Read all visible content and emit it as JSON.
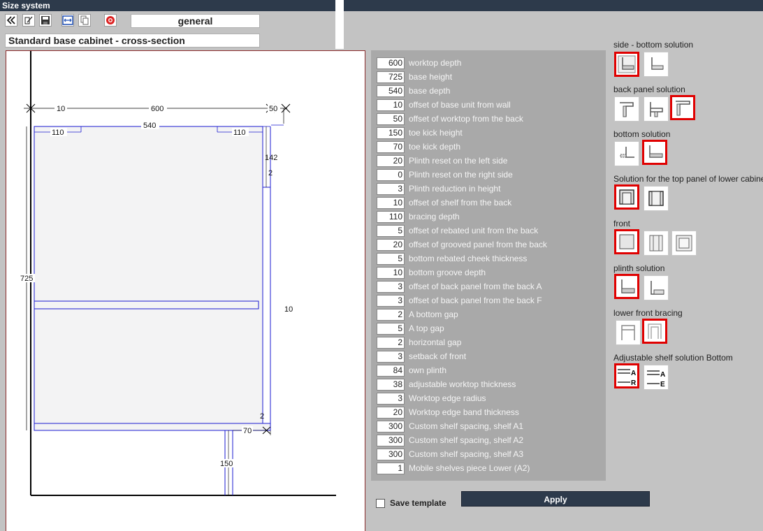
{
  "window": {
    "title": "Size system"
  },
  "toolbar": {
    "general_label": "general",
    "buttons": [
      "back-icon",
      "open-icon",
      "save-icon",
      "resize-icon",
      "copy-icon",
      "help-icon"
    ]
  },
  "section": {
    "title": "Standard base cabinet - cross-section"
  },
  "drawing": {
    "dims": {
      "d10": "10",
      "d600": "600",
      "d50": "50",
      "d110a": "110",
      "d540": "540",
      "d110b": "110",
      "d142": "142",
      "d2a": "2",
      "d725": "725",
      "d10b": "10",
      "d2b": "2",
      "d70": "70",
      "d150": "150"
    }
  },
  "params": [
    {
      "value": "600",
      "label": "worktop depth"
    },
    {
      "value": "725",
      "label": "base height"
    },
    {
      "value": "540",
      "label": "base depth"
    },
    {
      "value": "10",
      "label": "offset of base unit from wall"
    },
    {
      "value": "50",
      "label": "offset of worktop from the back"
    },
    {
      "value": "150",
      "label": "toe kick height"
    },
    {
      "value": "70",
      "label": "toe kick depth"
    },
    {
      "value": "20",
      "label": "Plinth reset on the left side"
    },
    {
      "value": "0",
      "label": "Plinth reset on the right side"
    },
    {
      "value": "3",
      "label": "Plinth reduction in height"
    },
    {
      "value": "10",
      "label": "offset of shelf from the back"
    },
    {
      "value": "110",
      "label": "bracing depth"
    },
    {
      "value": "5",
      "label": "offset of rebated unit from the back"
    },
    {
      "value": "20",
      "label": "offset of grooved panel from the back"
    },
    {
      "value": "5",
      "label": "bottom rebated cheek thickness"
    },
    {
      "value": "10",
      "label": "bottom groove depth"
    },
    {
      "value": "3",
      "label": "offset of back panel from the back A"
    },
    {
      "value": "3",
      "label": "offset of back panel from the back F"
    },
    {
      "value": "2",
      "label": "A bottom gap"
    },
    {
      "value": "5",
      "label": "A top gap"
    },
    {
      "value": "2",
      "label": "horizontal gap"
    },
    {
      "value": "3",
      "label": "setback of front"
    },
    {
      "value": "84",
      "label": "own plinth"
    },
    {
      "value": "38",
      "label": "adjustable worktop thickness"
    },
    {
      "value": "3",
      "label": "Worktop edge radius"
    },
    {
      "value": "20",
      "label": "Worktop edge band thickness"
    },
    {
      "value": "300",
      "label": "Custom shelf spacing, shelf A1"
    },
    {
      "value": "300",
      "label": "Custom shelf spacing, shelf A2"
    },
    {
      "value": "300",
      "label": "Custom shelf spacing, shelf A3"
    },
    {
      "value": "1",
      "label": "Mobile shelves piece Lower (A2)"
    }
  ],
  "options": {
    "side_bottom": "side - bottom solution",
    "back_panel": "back panel solution",
    "bottom": "bottom solution",
    "top_panel": "Solution for the top panel of lower cabinet",
    "front": "front",
    "plinth": "plinth solution",
    "lower_bracing": "lower front bracing",
    "adj_shelf": "Adjustable shelf solution Bottom",
    "letters": {
      "a": "A",
      "r": "R",
      "e": "E"
    }
  },
  "footer": {
    "save_template": "Save template",
    "apply": "Apply"
  },
  "colors": {
    "titlebar": "#2d3a4b",
    "selected": "#e00000",
    "panel": "#a9a9a9",
    "dimension": "#1a1ad0"
  }
}
